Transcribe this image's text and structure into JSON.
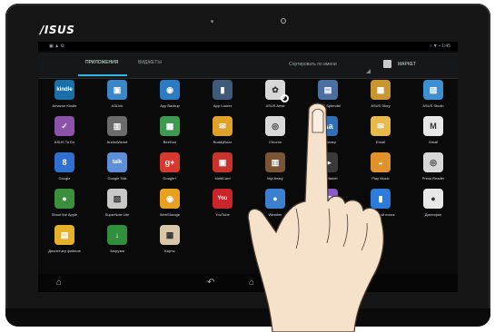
{
  "device": {
    "brand": "/ISUS"
  },
  "statusbar": {
    "left_text": "▣ ▲ ⚙",
    "right_text": "↓ ▼ ▪ 1:45"
  },
  "tabs": [
    {
      "label": "ПРИЛОЖЕНИЯ"
    },
    {
      "label": "ВИДЖЕТЫ"
    }
  ],
  "toolbar": {
    "sort_label": "Сортировать по имени",
    "market_label": "МАРКЕТ"
  },
  "apps": [
    {
      "label": "Amazon Kindle",
      "glyph": "kindle",
      "color": "#1b6fa8"
    },
    {
      "label": "ASLink",
      "glyph": "▣",
      "color": "#3a86c8"
    },
    {
      "label": "App Backup",
      "glyph": "◉",
      "color": "#2b7bc4"
    },
    {
      "label": "App Locker",
      "glyph": "▮",
      "color": "#3d5a7a"
    },
    {
      "label": "ASUS Artist",
      "glyph": "✿",
      "color": "#d8d8d8"
    },
    {
      "label": "ASUS Splendid",
      "glyph": "▤",
      "color": "#4a6fa0"
    },
    {
      "label": "ASUS Story",
      "glyph": "▦",
      "color": "#c9952e"
    },
    {
      "label": "ASUS Studio",
      "glyph": "▨",
      "color": "#3c8fd0"
    },
    {
      "label": "ASUS To Do",
      "glyph": "✓",
      "color": "#8a52a8"
    },
    {
      "label": "AudioWizard",
      "glyph": "▥",
      "color": "#6b6b6b"
    },
    {
      "label": "BeeDoo",
      "glyph": "▩",
      "color": "#3c9b4f"
    },
    {
      "label": "BuddyBuzz",
      "glyph": "✉",
      "color": "#e0a12a"
    },
    {
      "label": "Chrome",
      "glyph": "◎",
      "color": "#d9d9d9"
    },
    {
      "label": "Dictionary",
      "glyph": "Aa",
      "color": "#2f6fb3"
    },
    {
      "label": "Email",
      "glyph": "✉",
      "color": "#e6b94a"
    },
    {
      "label": "Gmail",
      "glyph": "M",
      "color": "#e8e8e8"
    },
    {
      "label": "Google",
      "glyph": "8",
      "color": "#2f6fd0"
    },
    {
      "label": "Google Talk",
      "glyph": "talk",
      "color": "#5f8ed8"
    },
    {
      "label": "Google+",
      "glyph": "g+",
      "color": "#d7382e"
    },
    {
      "label": "MultiCard",
      "glyph": "▣",
      "color": "#c8342c"
    },
    {
      "label": "MyLibrary",
      "glyph": "▥",
      "color": "#7a5535"
    },
    {
      "label": "Play Market",
      "glyph": "▶",
      "color": "#3a3a3a"
    },
    {
      "label": "Play Music",
      "glyph": "◒",
      "color": "#e0922a"
    },
    {
      "label": "Press Reader",
      "glyph": "◎",
      "color": "#d8d8d8"
    },
    {
      "label": "Shoot the Apple",
      "glyph": "●",
      "color": "#3c8f3a"
    },
    {
      "label": "SuperNote Lite",
      "glyph": "▧",
      "color": "#c8c8c8"
    },
    {
      "label": "WebStorage",
      "glyph": "◉",
      "color": "#e8a11f"
    },
    {
      "label": "YouTube",
      "glyph": "You",
      "color": "#c8262a"
    },
    {
      "label": "Weather",
      "glyph": "●",
      "color": "#3b7fd0"
    },
    {
      "label": "Галерея",
      "glyph": "▨",
      "color": "#8b5cc8"
    },
    {
      "label": "Голосовой поиск",
      "glyph": "▮",
      "color": "#2b7bd8"
    },
    {
      "label": "Диктофон",
      "glyph": "●",
      "color": "#e8e8e8"
    },
    {
      "label": "Диспетчер файлов",
      "glyph": "▤",
      "color": "#e6b02a"
    },
    {
      "label": "Загрузки",
      "glyph": "↓",
      "color": "#2f8f3a"
    },
    {
      "label": "Карты",
      "glyph": "▦",
      "color": "#d8c8a8"
    }
  ],
  "navbar": {
    "left_icon": "⌂",
    "back_icon": "↶",
    "home_icon": "⌂"
  },
  "icons": {
    "hand": "pointing-hand-icon",
    "market": "bag-icon"
  }
}
